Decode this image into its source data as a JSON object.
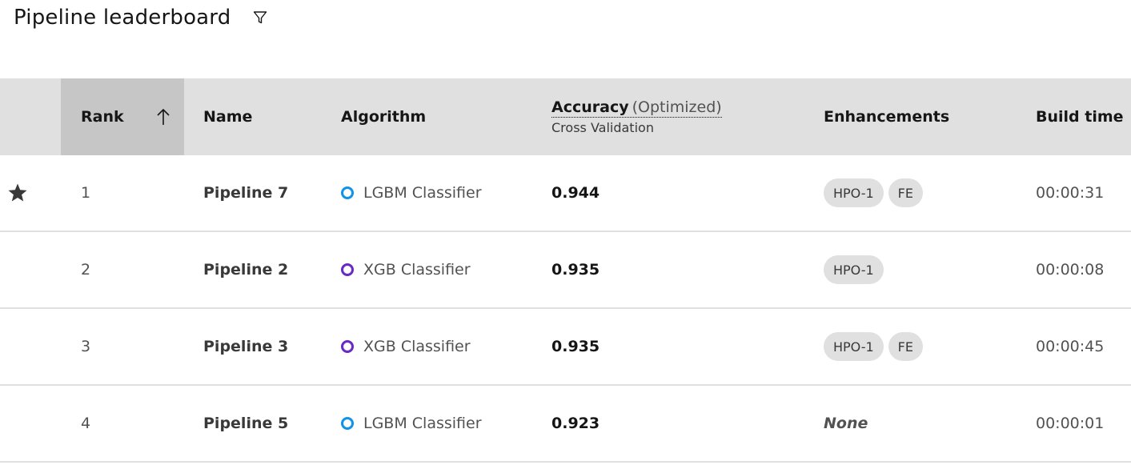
{
  "header": {
    "title": "Pipeline leaderboard",
    "filter_icon": "filter-icon"
  },
  "columns": {
    "rank": "Rank",
    "name": "Name",
    "algorithm": "Algorithm",
    "accuracy": "Accuracy",
    "accuracy_suffix": "(Optimized)",
    "accuracy_sub": "Cross Validation",
    "enhancements": "Enhancements",
    "build_time": "Build time",
    "sort_icon": "arrow-up-icon"
  },
  "colors": {
    "lgbm": "#1192e8",
    "xgb": "#6929c4",
    "header_bg": "#e0e0e0",
    "sorted_header_bg": "#c6c6c6"
  },
  "rows": [
    {
      "starred": true,
      "rank": "1",
      "name": "Pipeline 7",
      "algorithm": "LGBM Classifier",
      "algo_color": "#1192e8",
      "accuracy": "0.944",
      "enhancements": [
        "HPO-1",
        "FE"
      ],
      "build_time": "00:00:31"
    },
    {
      "starred": false,
      "rank": "2",
      "name": "Pipeline 2",
      "algorithm": "XGB Classifier",
      "algo_color": "#6929c4",
      "accuracy": "0.935",
      "enhancements": [
        "HPO-1"
      ],
      "build_time": "00:00:08"
    },
    {
      "starred": false,
      "rank": "3",
      "name": "Pipeline 3",
      "algorithm": "XGB Classifier",
      "algo_color": "#6929c4",
      "accuracy": "0.935",
      "enhancements": [
        "HPO-1",
        "FE"
      ],
      "build_time": "00:00:45"
    },
    {
      "starred": false,
      "rank": "4",
      "name": "Pipeline 5",
      "algorithm": "LGBM Classifier",
      "algo_color": "#1192e8",
      "accuracy": "0.923",
      "enhancements": [],
      "enhancements_empty": "None",
      "build_time": "00:00:01"
    }
  ]
}
